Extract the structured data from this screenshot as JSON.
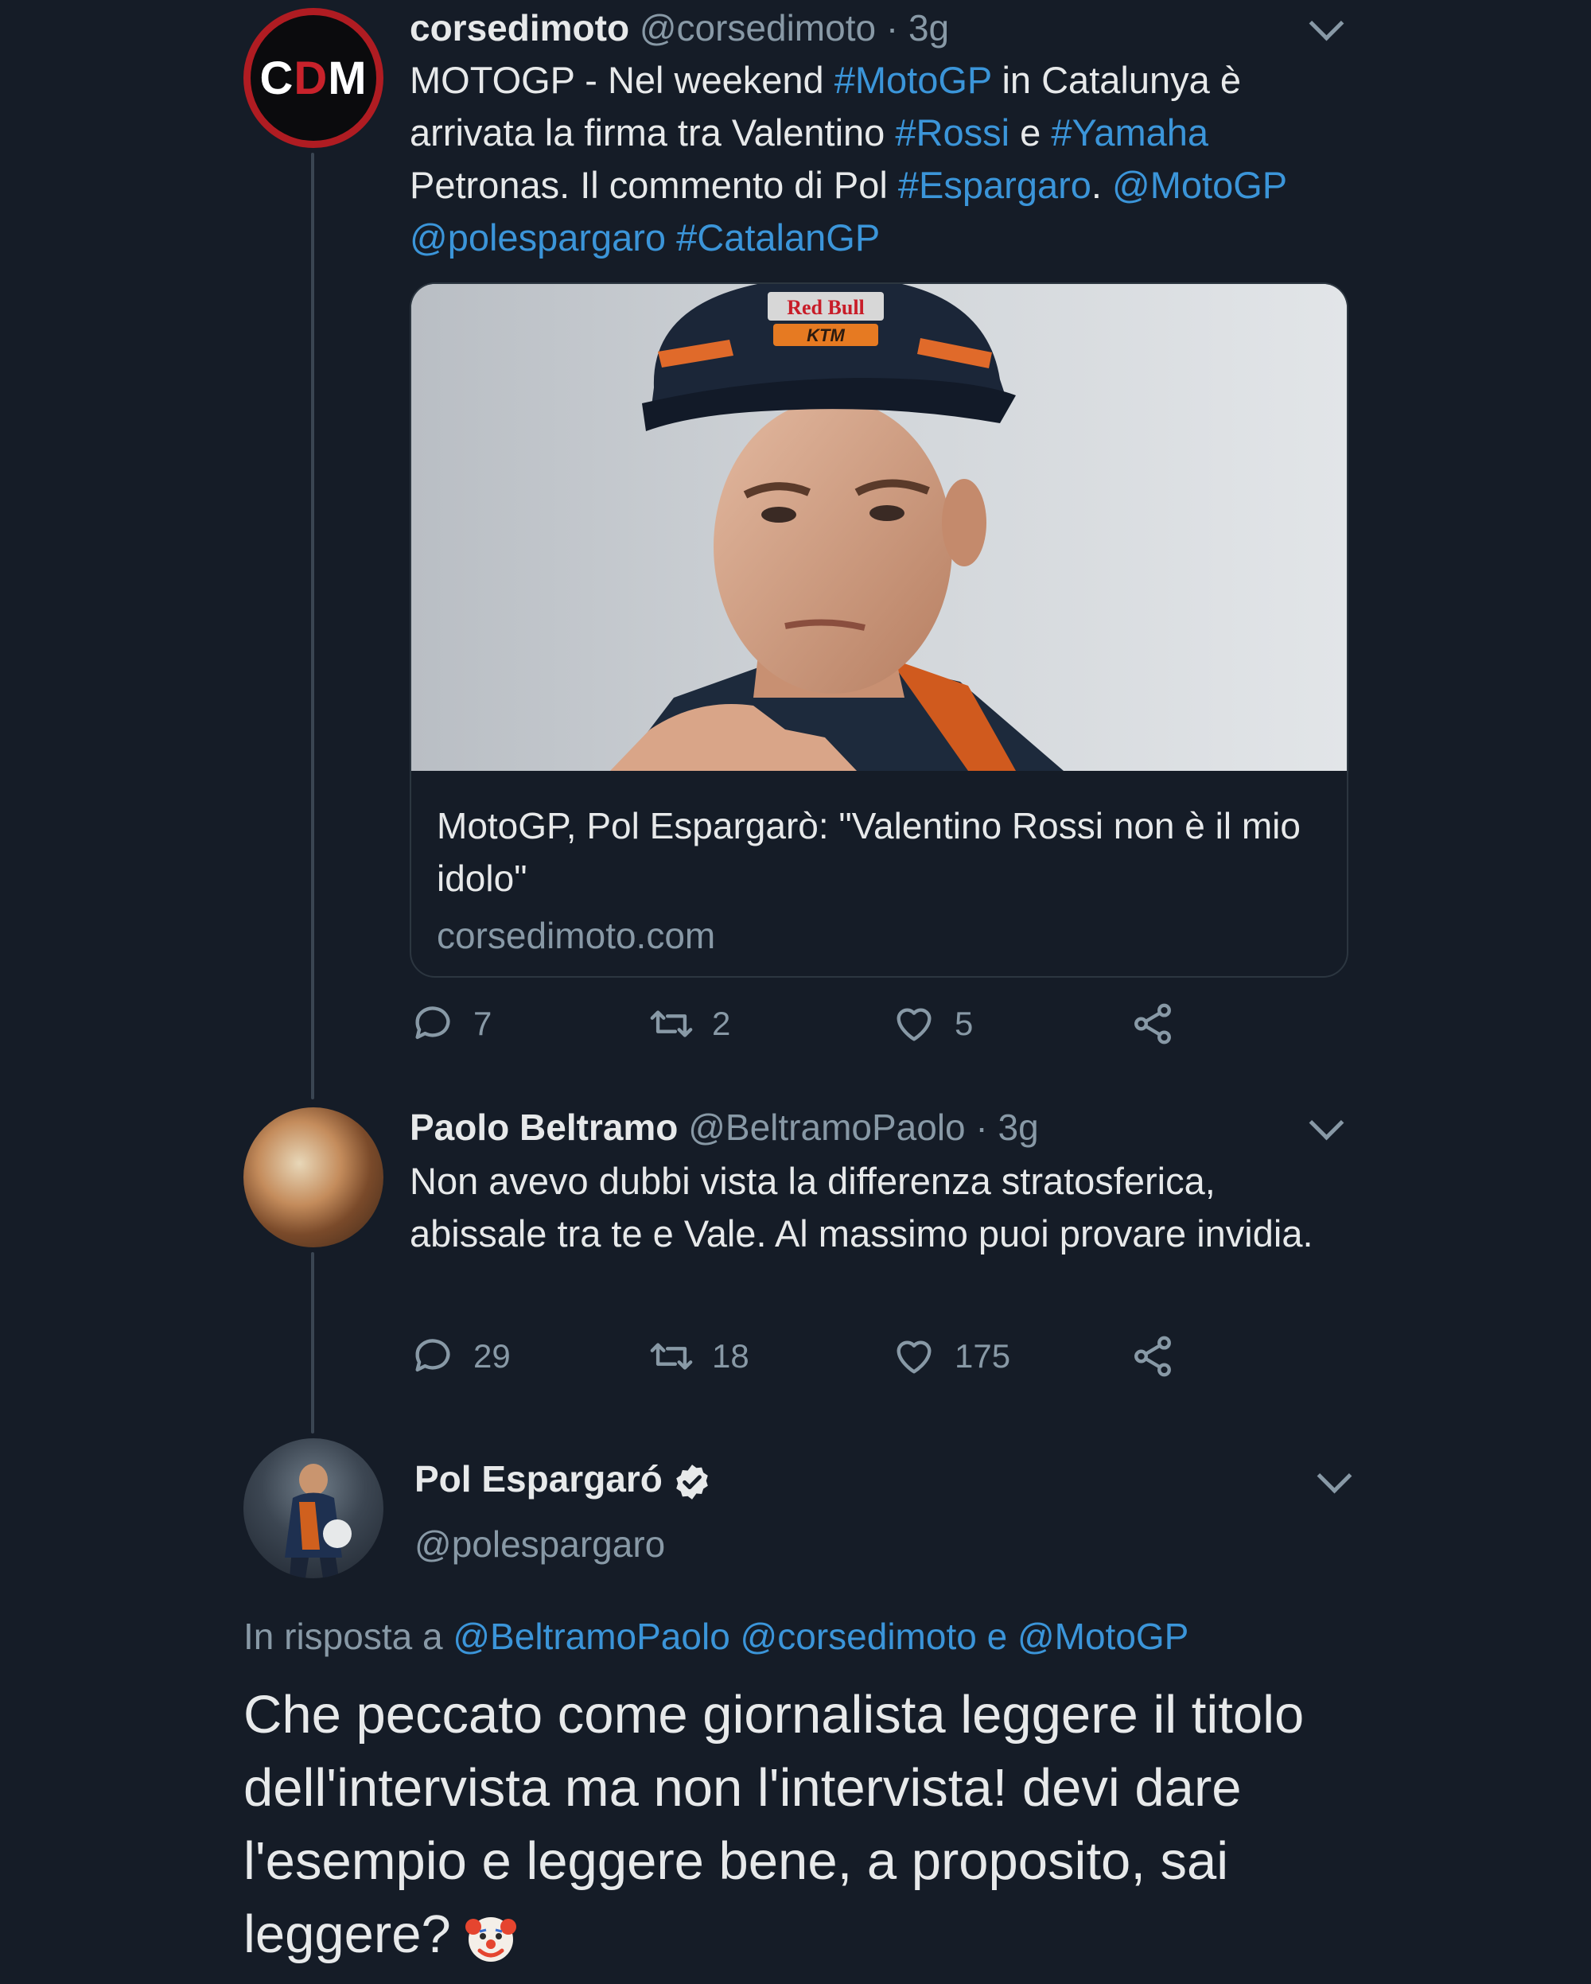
{
  "tweet1": {
    "avatar_text_left": "C",
    "avatar_text_mid": "D",
    "avatar_text_right": "M",
    "name": "corsedimoto",
    "handle": "@corsedimoto",
    "time": "· 3g",
    "text_parts": {
      "p1": "MOTOGP - Nel weekend ",
      "h1": "#MotoGP",
      "p2": " in Catalunya è arrivata la firma tra Valentino ",
      "h2": "#Rossi",
      "p3": " e ",
      "h3": "#Yamaha",
      "p4": " Petronas. Il commento di Pol ",
      "h4": "#Espargaro",
      "p5": ". ",
      "m1": "@MotoGP",
      "p6": " ",
      "m2": "@polespargaro",
      "p7": " ",
      "h5": "#CatalanGP"
    },
    "card": {
      "title": "MotoGP, Pol Espargarò: \"Valentino Rossi non è il mio idolo\"",
      "domain": "corsedimoto.com",
      "cap_brand_top": "Red Bull",
      "cap_brand_bottom": "KTM"
    },
    "actions": {
      "replies": "7",
      "retweets": "2",
      "likes": "5"
    }
  },
  "tweet2": {
    "name": "Paolo Beltramo",
    "handle": "@BeltramoPaolo",
    "time": "· 3g",
    "text": "Non avevo dubbi vista la differenza stratosferica, abissale tra te e Vale. Al massimo puoi provare invidia.",
    "actions": {
      "replies": "29",
      "retweets": "18",
      "likes": "175"
    }
  },
  "tweet3": {
    "name": "Pol Espargaró",
    "handle": "@polespargaro",
    "reply_prefix": "In risposta a",
    "reply_users": "@BeltramoPaolo @corsedimoto e @MotoGP",
    "text": "Che peccato come giornalista leggere il titolo dell'intervista ma non l'intervista! devi dare l'esempio e leggere bene, a proposito, sai leggere?"
  },
  "icons": {
    "reply": "reply-icon",
    "retweet": "retweet-icon",
    "like": "heart-icon",
    "share": "share-icon",
    "more": "chevron-down-icon",
    "verified": "verified-badge-icon",
    "emoji": "clown-face-icon"
  },
  "colors": {
    "background": "#151c27",
    "text": "#e7e9ea",
    "muted": "#8899a6",
    "link": "#3b95d9",
    "thread_line": "#3a4552",
    "brand_red": "#b01c22"
  }
}
